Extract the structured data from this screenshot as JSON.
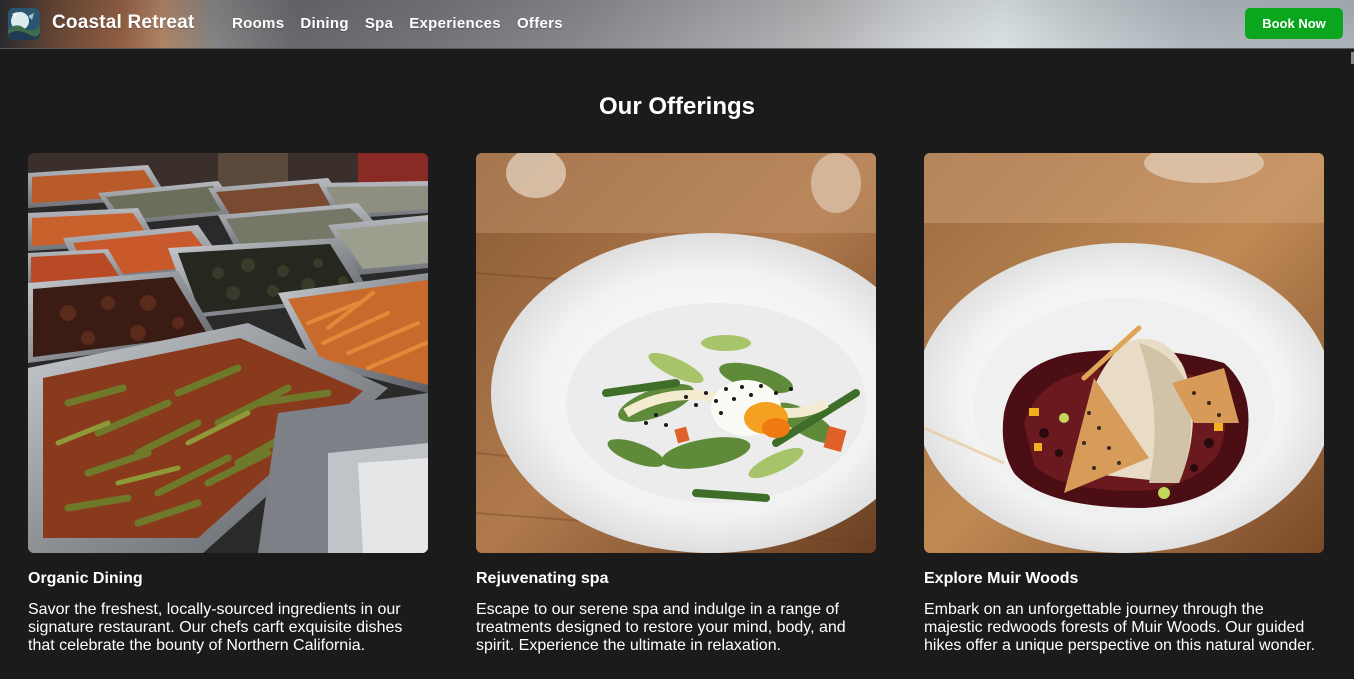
{
  "header": {
    "brand": "Coastal Retreat",
    "logo_icon": "coastal-landscape-logo",
    "nav": [
      "Rooms",
      "Dining",
      "Spa",
      "Experiences",
      "Offers"
    ],
    "cta_label": "Book Now",
    "cta_color": "#0aa61d"
  },
  "main": {
    "title": "Our Offerings",
    "cards": [
      {
        "image": "buffet-trays-photo",
        "title": "Organic Dining",
        "description": "Savor the freshest, locally-sourced ingredients in our signature restaurant. Our chefs carft exquisite dishes that celebrate the bounty of Northern California."
      },
      {
        "image": "salad-egg-plate-photo",
        "title": "Rejuvenating spa",
        "description": "Escape to our serene spa and indulge in a range of treatments designed to restore your mind, body, and spirit. Experience the ultimate in relaxation."
      },
      {
        "image": "plated-dessert-photo",
        "title": "Explore Muir Woods",
        "description": "Embark on an unforgettable journey through the majestic redwoods forests of Muir Woods. Our guided hikes offer a unique perspective on this natural wonder."
      }
    ]
  },
  "colors": {
    "background": "#1b1b1c",
    "text": "#ffffff"
  }
}
